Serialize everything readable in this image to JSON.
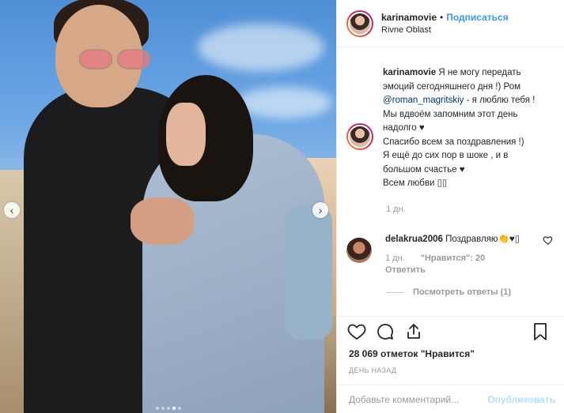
{
  "post": {
    "username": "karinamovie",
    "separator": "•",
    "follow_label": "Подписаться",
    "location": "Rivne Oblast"
  },
  "caption": {
    "username": "karinamovie",
    "part1": "Я не могу передать эмоций сегодняшнего дня !) Ром ",
    "mention": "@roman_magritskiy",
    "part2": " - я люблю тебя !",
    "line2": "Мы вдвоём запомним этот день надолго ♥",
    "line3": "Спасибо всем за поздравления !)",
    "line4": "Я ещё до сих пор в шоке , и в большом счастье ♥",
    "line5": "Всем любви ▯▯",
    "time": "1 дн."
  },
  "comment": {
    "username": "delakrua2006",
    "text": "Поздравляю👏♥▯",
    "time": "1 дн.",
    "likes": "\"Нравится\": 20",
    "reply": "Ответить",
    "view_replies": "Посмотреть ответы (1)"
  },
  "footer": {
    "likes": "28 069 отметок \"Нравится\"",
    "time_ago": "ДЕНЬ НАЗАД",
    "comment_placeholder": "Добавьте комментарий...",
    "publish": "Опубликовать"
  },
  "carousel": {
    "prev": "‹",
    "next": "›",
    "slide_count": 5,
    "active_slide": 4
  },
  "colors": {
    "link": "#3897f0",
    "mention": "#003569",
    "muted": "#999999",
    "publish_disabled": "#b2dffc"
  },
  "icons": [
    "heart-icon",
    "comment-icon",
    "share-icon",
    "bookmark-icon",
    "chevron-left-icon",
    "chevron-right-icon"
  ]
}
